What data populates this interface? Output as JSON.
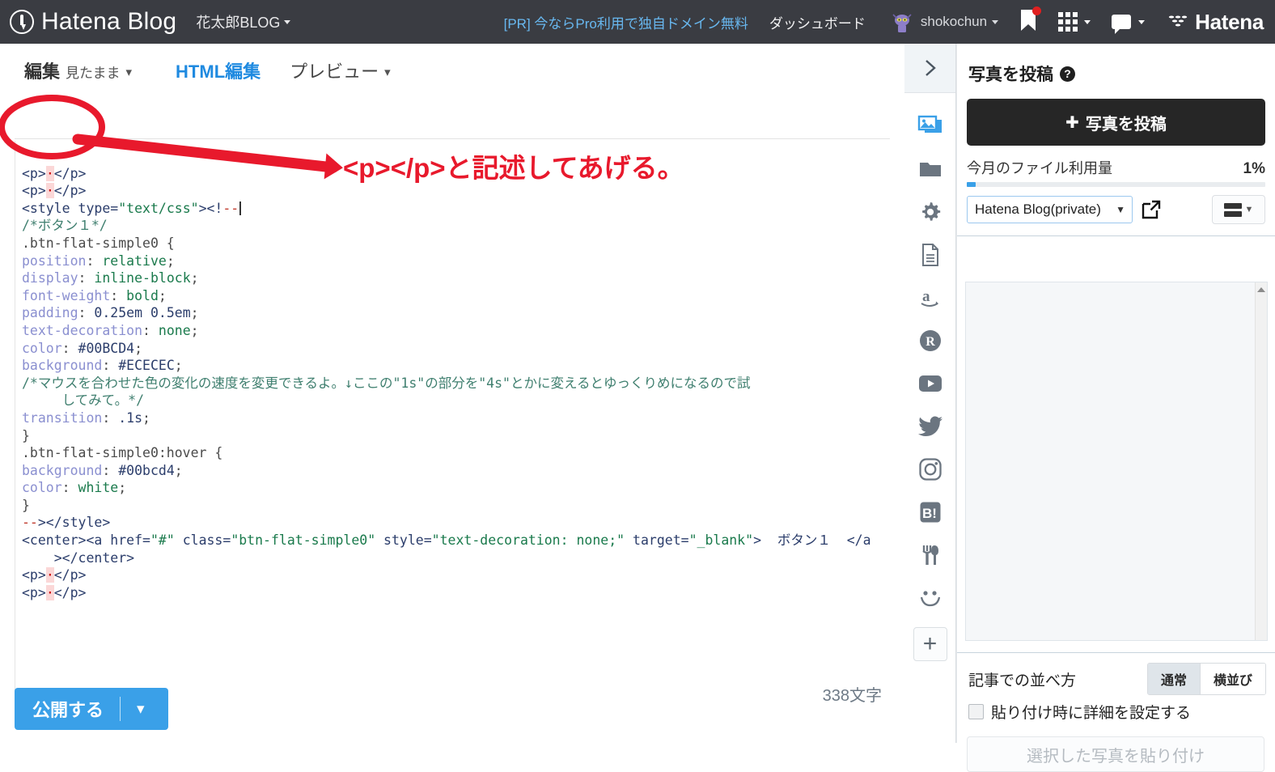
{
  "header": {
    "brand": "Hatena Blog",
    "brand_logo_icon": "hatena-pen-logo-icon",
    "blog_name": "花太郎BLOG",
    "pr_link": "[PR] 今ならPro利用で独自ドメイン無料",
    "dashboard_link": "ダッシュボード",
    "user_name": "shokochun",
    "avatar_icon": "user-avatar",
    "icons": [
      "bookmark-icon",
      "apps-grid-icon",
      "comment-balloon-icon"
    ],
    "hatena_label": "Hatena",
    "bg_color": "#3a3c42",
    "pr_link_color": "#68b8f0"
  },
  "editor": {
    "tabs": [
      {
        "label": "編集",
        "sub": "見たまま",
        "has_caret": true,
        "active": false
      },
      {
        "label": "HTML編集",
        "sub": "",
        "has_caret": false,
        "active": true
      },
      {
        "label": "プレビュー",
        "sub": "",
        "has_caret": true,
        "active": false
      }
    ],
    "active_tab_color": "#1f8ae0",
    "char_count": "338文字",
    "publish_button": "公開する",
    "publish_caret": "chevron-down-icon",
    "publish_color": "#3aa0e8",
    "code_lines": [
      "<p>·</p>",
      "<p>·</p>",
      "<style type=\"text/css\"><!--",
      "/*ボタン１*/",
      ".btn-flat-simple0 {",
      "position: relative;",
      "display: inline-block;",
      "font-weight: bold;",
      "padding: 0.25em 0.5em;",
      "text-decoration: none;",
      "color: #00BCD4;",
      "background: #ECECEC;",
      "/*マウスを合わせた色の変化の速度を変更できるよ。↓ここの\"1s\"の部分を\"4s\"とかに変えるとゆっくりめになるので試",
      "    してみて。*/",
      "transition: .1s;",
      "}",
      ".btn-flat-simple0:hover {",
      "background: #00bcd4;",
      "color: white;",
      "}",
      "--></style>",
      "<center><a href=\"#\" class=\"btn-flat-simple0\" style=\"text-decoration: none;\" target=\"_blank\">  ボタン１  </a",
      "    ></center>",
      "<p>·</p>",
      "<p>·</p>"
    ]
  },
  "rail": {
    "toggle_icon": "chevron-right-icon",
    "items": [
      "photo-icon",
      "folder-icon",
      "gear-icon",
      "document-icon",
      "amazon-icon",
      "rakuten-icon",
      "youtube-icon",
      "twitter-icon",
      "instagram-icon",
      "hatena-bookmark-icon",
      "restaurant-icon",
      "smiley-icon"
    ],
    "add_icon": "plus-icon"
  },
  "photo_panel": {
    "title": "写真を投稿",
    "help_icon": "question-mark-icon",
    "upload_button": "写真を投稿",
    "upload_plus_icon": "plus-icon",
    "usage_label": "今月のファイル利用量",
    "usage_percent": "1%",
    "usage_value": 1,
    "folder_select_value": "Hatena Blog(private)",
    "folder_select_caret": "chevron-down-icon",
    "external_link_icon": "external-link-icon",
    "view_mode_icon": "list-view-icon",
    "view_mode_caret": "chevron-down-icon",
    "scroll_up_icon": "scroll-up-arrow-icon",
    "order_label": "記事での並べ方",
    "order_options": [
      "通常",
      "横並び"
    ],
    "order_selected": "通常",
    "detail_checkbox_label": "貼り付け時に詳細を設定する",
    "detail_checkbox_checked": false,
    "paste_button": "選択した写真を貼り付け"
  },
  "annotation": {
    "text": "<p></p>と記述してあげる。",
    "color": "#e8192c",
    "shape": "ellipse-with-arrow"
  }
}
